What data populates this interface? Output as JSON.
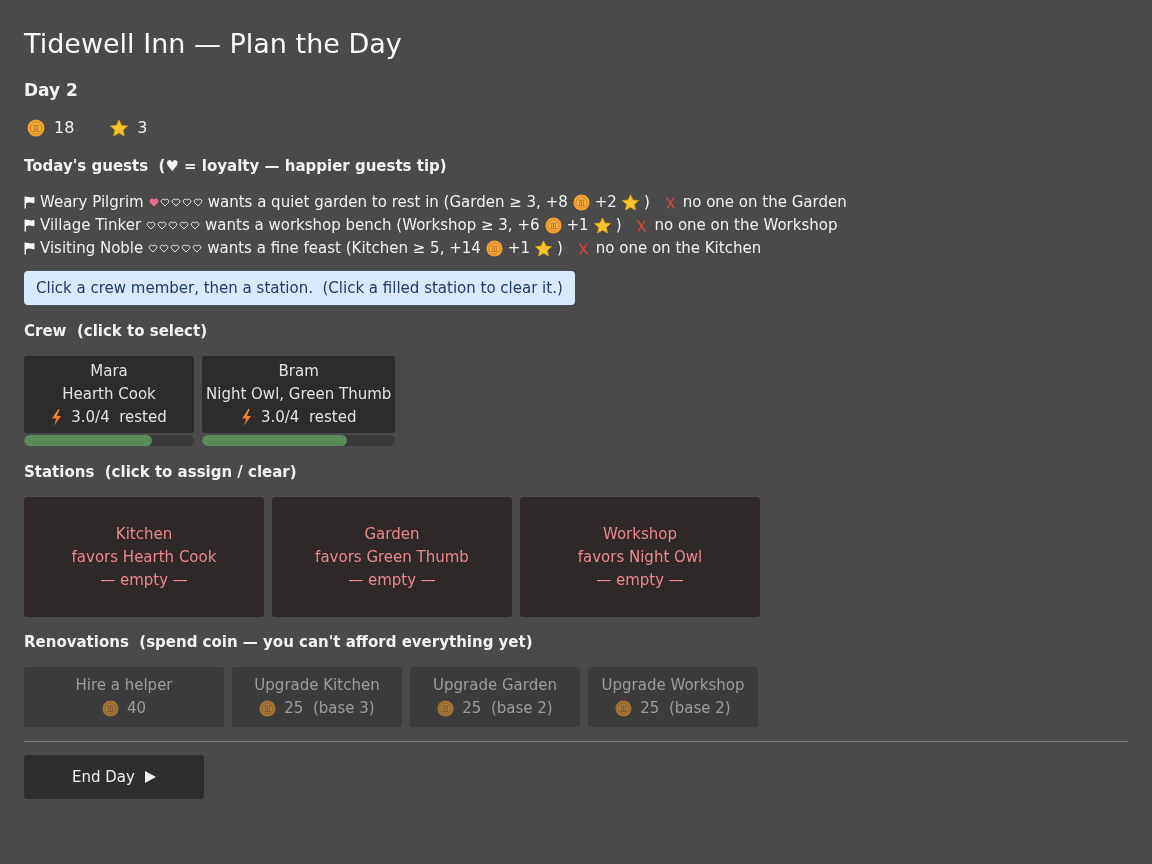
{
  "title": "Tidewell Inn — Plan the Day",
  "day": "Day 2",
  "stats": [
    {
      "kind": "coin",
      "value": "18"
    },
    {
      "kind": "star",
      "value": "3"
    }
  ],
  "guests_heading": "Today's guests  (♥ = loyalty — happier guests tip)",
  "guests": [
    {
      "name": "Weary Pilgrim",
      "stars": 1,
      "parts": [
        {
          "kind": "text",
          "text": "wants a quiet garden to rest in (Garden ≥ 3, +8"
        },
        {
          "kind": "coin"
        },
        {
          "kind": "text",
          "text": "+2"
        },
        {
          "kind": "star"
        },
        {
          "kind": "text",
          "text": ")"
        }
      ],
      "satisfied": false,
      "status": "no one on the Garden"
    },
    {
      "name": "Village Tinker",
      "stars": 0,
      "parts": [
        {
          "kind": "text",
          "text": "wants a workshop bench (Workshop ≥ 3, +6"
        },
        {
          "kind": "coin"
        },
        {
          "kind": "text",
          "text": "+1"
        },
        {
          "kind": "star"
        },
        {
          "kind": "text",
          "text": ")"
        }
      ],
      "satisfied": false,
      "status": "no one on the Workshop"
    },
    {
      "name": "Visiting Noble",
      "stars": 0,
      "parts": [
        {
          "kind": "text",
          "text": "wants a fine feast (Kitchen ≥ 5, +14"
        },
        {
          "kind": "coin"
        },
        {
          "kind": "text",
          "text": "+1"
        },
        {
          "kind": "star"
        },
        {
          "kind": "text",
          "text": ")"
        }
      ],
      "satisfied": false,
      "status": "no one on the Kitchen"
    }
  ],
  "hint": "Click a crew member, then a station.  (Click a filled station to clear it.)",
  "crew_heading": "Crew  (click to select)",
  "crew": [
    {
      "name": "Mara",
      "traits": "Hearth Cook",
      "energy": "3.0/4  rested",
      "level": 0.75,
      "selected": false
    },
    {
      "name": "Bram",
      "traits": "Night Owl, Green Thumb",
      "energy": "3.0/4  rested",
      "level": 0.75,
      "selected": false
    }
  ],
  "stations_heading": "Stations  (click to assign / clear)",
  "stations": [
    {
      "name": "Kitchen",
      "favors": "favors Hearth Cook",
      "occupant": "— empty —",
      "filled": false
    },
    {
      "name": "Garden",
      "favors": "favors Green Thumb",
      "occupant": "— empty —",
      "filled": false
    },
    {
      "name": "Workshop",
      "favors": "favors Night Owl",
      "occupant": "— empty —",
      "filled": false
    }
  ],
  "renovations_heading": "Renovations  (spend coin — you can't afford everything yet)",
  "renovations": [
    {
      "kind": "hire",
      "label": "Hire a helper",
      "cost": "40",
      "disabled": true
    },
    {
      "kind": "upgrade",
      "label": "Upgrade Kitchen",
      "cost": "25  (base 3)",
      "disabled": true
    },
    {
      "kind": "upgrade",
      "label": "Upgrade Garden",
      "cost": "25  (base 2)",
      "disabled": true
    },
    {
      "kind": "upgrade",
      "label": "Upgrade Workshop",
      "cost": "25  (base 2)",
      "disabled": true
    }
  ],
  "end_button": {
    "label": "End Day"
  }
}
